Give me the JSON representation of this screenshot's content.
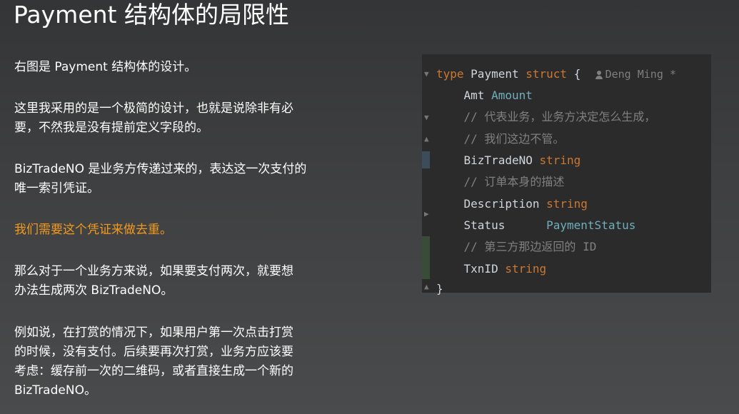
{
  "slide": {
    "title": "Payment 结构体的局限性",
    "paragraphs": [
      [
        "右图是 Payment 结构体的设计。"
      ],
      [
        "这里我采用的是一个极简的设计，也就是说除非有必",
        "要，不然我是没有提前定义字段的。"
      ],
      [
        "BizTradeNO 是业务方传递过来的，表达这一次支付的",
        "唯一索引凭证。"
      ],
      [
        "我们需要这个凭证来做去重。"
      ],
      [
        "那么对于一个业务方来说，如果要支付两次，就要想",
        "办法生成两次 BizTradeNO。"
      ],
      [
        "例如说，在打赏的情况下，如果用户第一次点击打赏",
        "的时候，没有支付。后续要再次打赏，业务方应该要",
        "考虑：缓存前一次的二维码，或者直接生成一个新的",
        "BizTradeNO。"
      ]
    ],
    "highlight_color": "#f39a1e"
  },
  "code": {
    "line1": {
      "kw_type": "type",
      "name": "Payment",
      "kw_struct": "struct",
      "brace": "{",
      "author": "Deng Ming",
      "star": "*"
    },
    "line2": {
      "field": "Amt",
      "type": "Amount"
    },
    "line3": {
      "comment": "// 代表业务，业务方决定怎么生成，"
    },
    "line4": {
      "comment": "// 我们这边不管。"
    },
    "line5": {
      "field": "BizTradeNO",
      "type": "string"
    },
    "line6": {
      "comment": "// 订单本身的描述"
    },
    "line7": {
      "field": "Description",
      "type": "string"
    },
    "line8": {
      "field": "Status",
      "type": "PaymentStatus"
    },
    "line9": {
      "comment": "// 第三方那边返回的 ID"
    },
    "line10": {
      "field": "TxnID",
      "type": "string"
    },
    "line11": {
      "brace": "}"
    },
    "colors": {
      "keyword": "#cc7832",
      "type": "#6fafbd",
      "comment": "#808080",
      "background": "#2b2b2b"
    }
  }
}
